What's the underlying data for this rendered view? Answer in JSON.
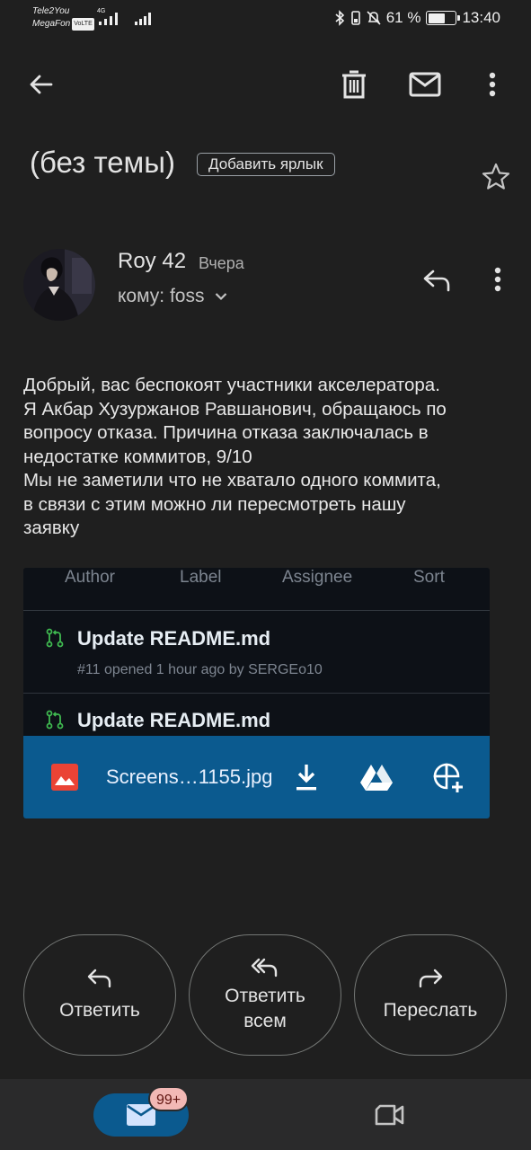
{
  "status_bar": {
    "carrier_1": "Tele2You",
    "carrier_2": "MegaFon",
    "volte": "VoLTE",
    "network": "4G",
    "battery_percent": "61 %",
    "battery_level": 0.61,
    "time": "13:40"
  },
  "toolbar": {
    "back_icon": "arrow-left-icon",
    "delete_icon": "trash-icon",
    "mark_unread_icon": "mail-icon",
    "more_icon": "more-vert-icon"
  },
  "subject": {
    "text": "(без темы)",
    "add_label": "Добавить ярлык",
    "star_icon": "star-outline-icon"
  },
  "message": {
    "sender": "Roy 42",
    "date": "Вчера",
    "recipient": "кому: foss",
    "body_lines": [
      "Добрый, вас беспокоят участники акселератора.",
      "Я Акбар Хузуржанов Равшанович, обращаюсь по",
      "вопросу отказа. Причина отказа заключалась в",
      "недостатке коммитов, 9/10",
      "Мы не заметили что не хватало одного коммита,",
      "в связи с этим можно ли пересмотреть нашу",
      "заявку"
    ]
  },
  "attachment": {
    "preview": {
      "filters": [
        "Author",
        "Label",
        "Assignee",
        "Sort"
      ],
      "pull_requests": [
        {
          "title": "Update README.md",
          "meta": "#11 opened 1 hour ago by SERGEo10"
        },
        {
          "title": "Update README.md",
          "meta": ""
        }
      ]
    },
    "filename": "Screens…1155.jpg",
    "icons": [
      "image-icon",
      "download-icon",
      "drive-icon",
      "photos-add-icon"
    ]
  },
  "actions": {
    "reply": "Ответить",
    "reply_all_line1": "Ответить",
    "reply_all_line2": "всем",
    "forward": "Переслать"
  },
  "bottom_nav": {
    "mail_badge": "99+",
    "colors": {
      "accent": "#0b5a8f",
      "badge": "#f2b8b5"
    }
  }
}
